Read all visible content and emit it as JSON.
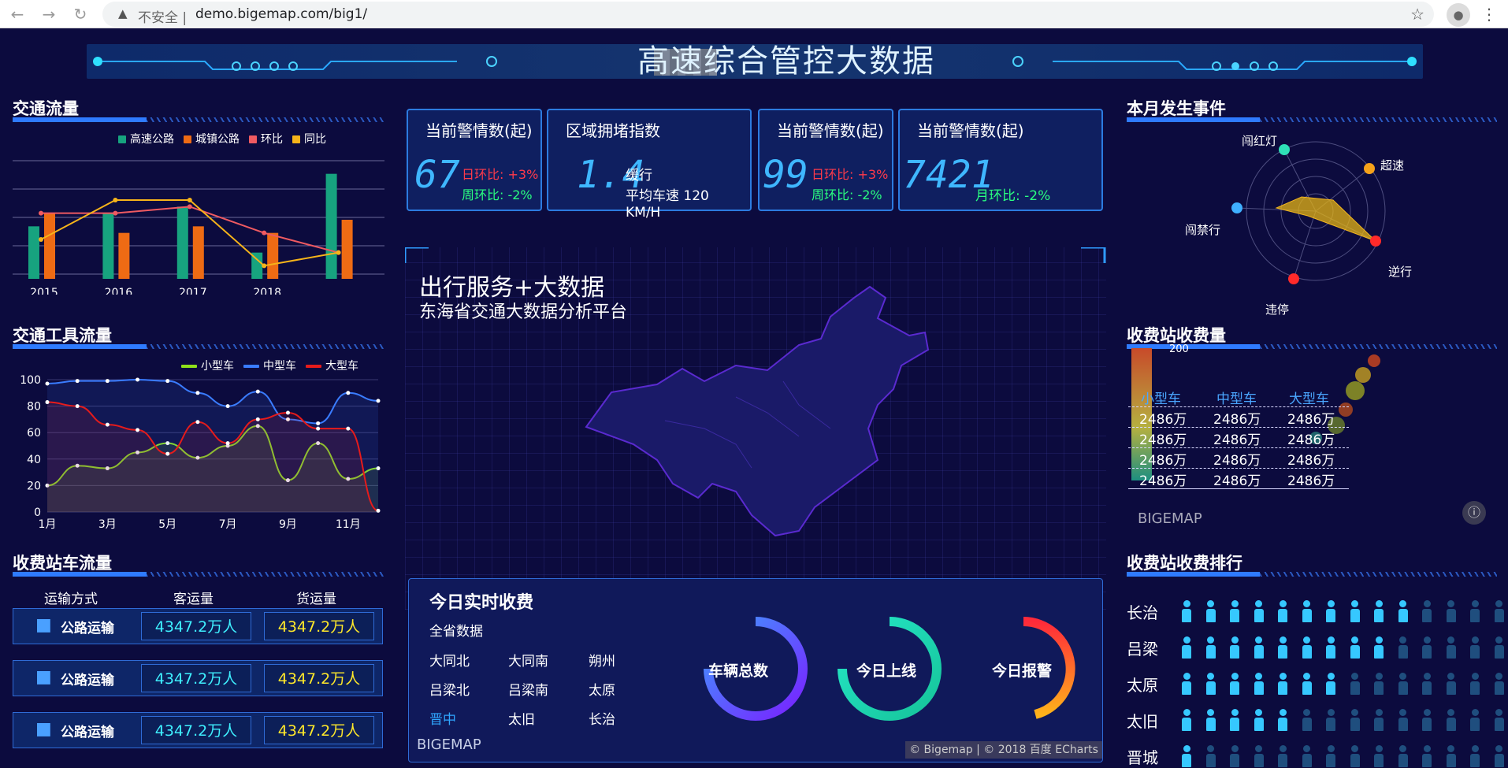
{
  "browser": {
    "back": "←",
    "fwd": "→",
    "reload": "↻",
    "warn": "▲",
    "insecure": "不安全 |",
    "url": "demo.bigemap.com/big1/",
    "star": "☆",
    "profile": "●",
    "kebab": "⋮"
  },
  "title": "高速综合管控大数据",
  "left": {
    "traffic_title": "交通流量",
    "legend": [
      {
        "name": "高速公路",
        "color": "#17a37f"
      },
      {
        "name": "城镇公路",
        "color": "#ee6b14"
      },
      {
        "name": "环比",
        "color": "#ef5a61"
      },
      {
        "name": "同比",
        "color": "#f6b41a"
      }
    ],
    "years": [
      "2015",
      "2016",
      "2017",
      "2018"
    ],
    "vehicle_title": "交通工具流量",
    "legend2": [
      {
        "name": "小型车",
        "color": "#8fe11a"
      },
      {
        "name": "中型车",
        "color": "#3a7cff"
      },
      {
        "name": "大型车",
        "color": "#e61b1b"
      }
    ],
    "yticks": [
      "100",
      "80",
      "60",
      "40",
      "20",
      "0"
    ],
    "xmonths": [
      "1月",
      "3月",
      "5月",
      "7月",
      "9月",
      "11月"
    ],
    "toll_title": "收费站车流量",
    "toll_headers": [
      "运输方式",
      "客运量",
      "货运量"
    ],
    "toll_rows": [
      {
        "type": "公路运输",
        "a": "4347.2万人",
        "b": "4347.2万人"
      },
      {
        "type": "公路运输",
        "a": "4347.2万人",
        "b": "4347.2万人"
      },
      {
        "type": "公路运输",
        "a": "4347.2万人",
        "b": "4347.2万人"
      }
    ]
  },
  "chart_data": [
    {
      "type": "bar",
      "title": "交通流量",
      "categories": [
        "2015",
        "2016",
        "2017",
        "2018",
        ""
      ],
      "series": [
        {
          "name": "高速公路",
          "values": [
            40,
            50,
            55,
            20,
            80
          ]
        },
        {
          "name": "城镇公路",
          "values": [
            50,
            35,
            40,
            35,
            45
          ]
        },
        {
          "name": "环比",
          "values": [
            50,
            50,
            55,
            35,
            20
          ]
        },
        {
          "name": "同比",
          "values": [
            30,
            60,
            60,
            10,
            20
          ]
        }
      ]
    },
    {
      "type": "line",
      "title": "交通工具流量",
      "ylim": [
        0,
        100
      ],
      "x": [
        "1月",
        "2月",
        "3月",
        "4月",
        "5月",
        "6月",
        "7月",
        "8月",
        "9月",
        "10月",
        "11月",
        "12月"
      ],
      "series": [
        {
          "name": "小型车",
          "values": [
            20,
            35,
            33,
            45,
            52,
            41,
            50,
            65,
            24,
            52,
            25,
            33
          ]
        },
        {
          "name": "中型车",
          "values": [
            97,
            99,
            99,
            100,
            99,
            90,
            80,
            91,
            70,
            67,
            90,
            84
          ]
        },
        {
          "name": "大型车",
          "values": [
            83,
            80,
            66,
            62,
            44,
            68,
            52,
            70,
            75,
            63,
            63,
            1
          ]
        }
      ]
    }
  ],
  "cards": [
    {
      "title": "当前警情数(起)",
      "num": "67",
      "l1": "日环比: +3%",
      "l2": "周环比: -2%"
    },
    {
      "title": "区域拥堵指数",
      "num": "1.4",
      "l1": "缓行",
      "l2": "平均车速 120",
      "l3": "KM/H"
    },
    {
      "title": "当前警情数(起)",
      "num": "99",
      "l1": "日环比: +3%",
      "l2": "周环比: -2%"
    },
    {
      "title": "当前警情数(起)",
      "num": "7421",
      "l1": "月环比: -2%"
    }
  ],
  "map": {
    "h1": "出行服务+大数据",
    "h2": "东海省交通大数据分析平台"
  },
  "today": {
    "title": "今日实时收费",
    "sub": "全省数据",
    "cities": [
      "大同北",
      "大同南",
      "朔州",
      "吕梁北",
      "吕梁南",
      "太原",
      "晋中",
      "太旧",
      "长治"
    ],
    "rings": [
      "车辆总数",
      "今日上线",
      "今日报警"
    ],
    "logo": "BIGEMAP",
    "copy": "© Bigemap | © 2018 百度 ECharts"
  },
  "right": {
    "events_title": "本月发生事件",
    "radar": [
      "闯红灯",
      "超速",
      "逆行",
      "违停",
      "闯禁行"
    ],
    "collect_title": "收费站收费量",
    "collect_headers": [
      "小型车",
      "中型车",
      "大型车"
    ],
    "collect_rows": [
      [
        "2486万",
        "2486万",
        "2486万"
      ],
      [
        "2486万",
        "2486万",
        "2486万"
      ],
      [
        "2486万",
        "2486万",
        "2486万"
      ],
      [
        "2486万",
        "2486万",
        "2486万"
      ]
    ],
    "collect_top": "200",
    "logo": "BIGEMAP",
    "rank_title": "收费站收费排行",
    "rank": [
      {
        "name": "长治",
        "lit": 10
      },
      {
        "name": "吕梁",
        "lit": 9
      },
      {
        "name": "太原",
        "lit": 7
      },
      {
        "name": "太旧",
        "lit": 5
      },
      {
        "name": "晋城",
        "lit": 1
      }
    ]
  }
}
